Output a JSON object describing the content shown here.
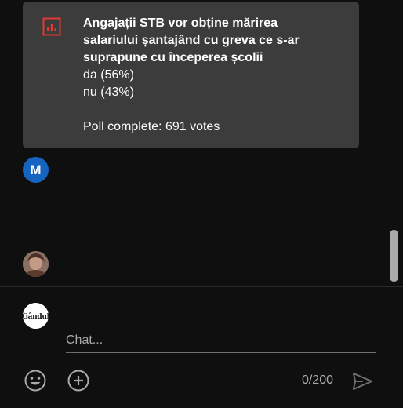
{
  "poll": {
    "question": "Angajații STB vor obține mărirea salariului șantajând cu greva ce s-ar suprapune cu începerea școlii",
    "options": [
      {
        "label": "da (56%)"
      },
      {
        "label": "nu (43%)"
      }
    ],
    "status": "Poll complete: 691 votes",
    "icon": "poll-chart-icon",
    "accent": "#e53935"
  },
  "avatars": [
    {
      "initial": "M",
      "color": "#1565c0"
    },
    {
      "type": "photo"
    },
    {
      "label": "Gândul"
    }
  ],
  "composer": {
    "placeholder": "Chat...",
    "char_count": "0/200"
  },
  "icons": {
    "emoji": "emoji-icon",
    "add": "add-icon",
    "send": "send-icon"
  }
}
